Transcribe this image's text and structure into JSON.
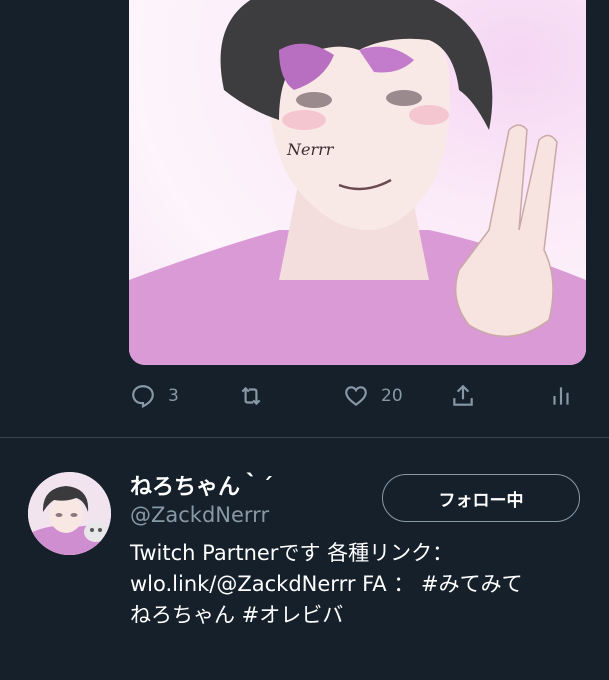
{
  "tweet": {
    "actions": {
      "reply_count": "3",
      "retweet_count": "",
      "like_count": "20"
    },
    "image_signature": "Nerrr"
  },
  "profile": {
    "display_name": "ねろちゃん｀´",
    "handle": "@ZackdNerrr",
    "follow_label": "フォロー中",
    "bio_line1": "Twitch Partnerです 各種リンク：",
    "bio_line2": "wlo.link/@ZackdNerrr FA ： #みてみて",
    "bio_line3": "ねろちゃん #オレビバ"
  },
  "colors": {
    "background": "#15202b",
    "muted": "#8899a6",
    "divider": "#38444d"
  }
}
